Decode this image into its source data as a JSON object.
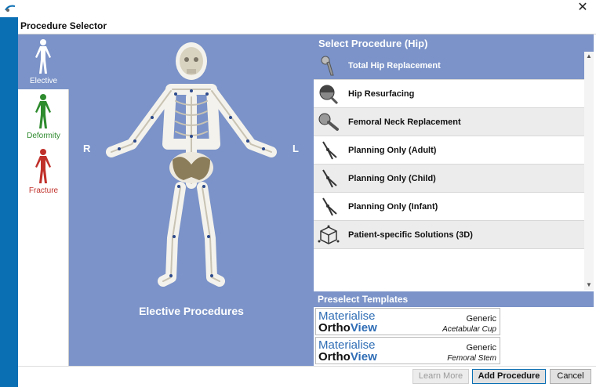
{
  "window": {
    "close_symbol": "✕"
  },
  "header": {
    "title": "Procedure Selector"
  },
  "nav": [
    {
      "label": "Elective",
      "color": "#ffffff",
      "label_color": "#ffffff",
      "active": true
    },
    {
      "label": "Deformity",
      "color": "#2e8b2e",
      "label_color": "#2e8b2e",
      "active": false
    },
    {
      "label": "Fracture",
      "color": "#c0302a",
      "label_color": "#c0302a",
      "active": false
    }
  ],
  "skeleton": {
    "right_marker": "R",
    "left_marker": "L",
    "caption": "Elective Procedures"
  },
  "procedures": {
    "header": "Select Procedure (Hip)",
    "items": [
      {
        "label": "Total Hip Replacement",
        "icon": "hip-stem-icon",
        "selected": true
      },
      {
        "label": "Hip Resurfacing",
        "icon": "resurfacing-cap-icon",
        "selected": false
      },
      {
        "label": "Femoral Neck Replacement",
        "icon": "neck-implant-icon",
        "selected": false
      },
      {
        "label": "Planning Only (Adult)",
        "icon": "caliper-icon",
        "selected": false
      },
      {
        "label": "Planning Only (Child)",
        "icon": "caliper-icon",
        "selected": false
      },
      {
        "label": "Planning Only (Infant)",
        "icon": "caliper-icon",
        "selected": false
      },
      {
        "label": "Patient-specific Solutions (3D)",
        "icon": "3d-cube-icon",
        "selected": false
      }
    ]
  },
  "preselect": {
    "header": "Preselect Templates",
    "templates": [
      {
        "brand_top": "Materialise",
        "brand_ortho": "Ortho",
        "brand_view": "View",
        "kind": "Generic",
        "part": "Acetabular Cup"
      },
      {
        "brand_top": "Materialise",
        "brand_ortho": "Ortho",
        "brand_view": "View",
        "kind": "Generic",
        "part": "Femoral Stem"
      }
    ]
  },
  "buttons": {
    "learn_more": "Learn More",
    "add_procedure": "Add Procedure",
    "cancel": "Cancel"
  },
  "colors": {
    "accent_blue": "#0b6fb4",
    "panel_blue": "#7b93c8"
  }
}
